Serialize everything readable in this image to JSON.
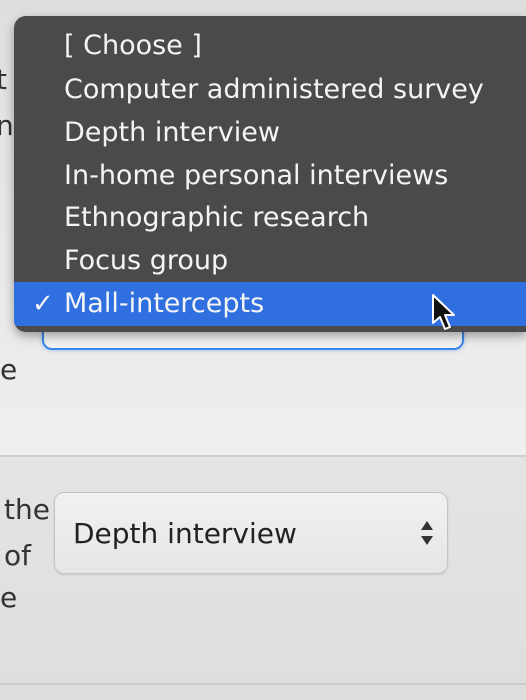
{
  "background_fragments": {
    "f1": "t",
    "f2": "n",
    "f3": "e",
    "f4": "the",
    "f5": "of",
    "f6": "e"
  },
  "dropdown": {
    "options": [
      "[ Choose ]",
      "Computer administered survey",
      "Depth interview",
      "In-home personal interviews",
      "Ethnographic research",
      "Focus group",
      "Mall-intercepts"
    ],
    "selected_index": 6,
    "check_glyph": "✓",
    "menu_color": "#4a4a4c",
    "highlight_color": "#2f6fe0"
  },
  "second_select": {
    "value": "Depth interview"
  },
  "icons": {
    "cursor": "arrow-cursor-icon",
    "select_arrows": "select-arrows-icon"
  }
}
